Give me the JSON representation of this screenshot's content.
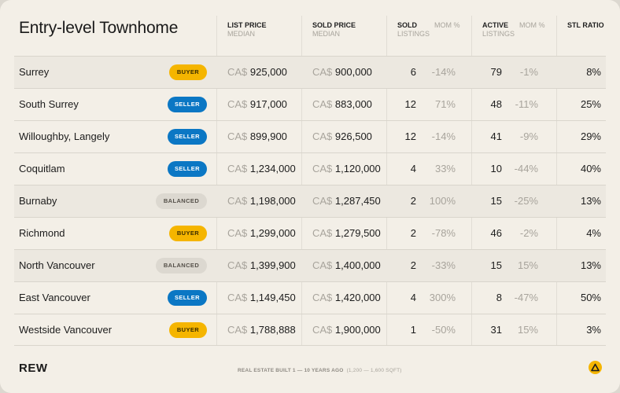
{
  "title": "Entry-level Townhome",
  "headers": {
    "list_price": "LIST PRICE",
    "list_price_sub": "MEDIAN",
    "sold_price": "SOLD PRICE",
    "sold_price_sub": "MEDIAN",
    "sold": "SOLD",
    "sold_sub": "LISTINGS",
    "sold_mom": "MOM %",
    "active": "ACTIVE",
    "active_sub": "LISTINGS",
    "active_mom": "MOM %",
    "stl": "STL RATIO"
  },
  "currency": "CA$",
  "rows": [
    {
      "city": "Surrey",
      "market": "BUYER",
      "market_type": "buyer",
      "list": "925,000",
      "sold_price": "900,000",
      "sold": "6",
      "sold_mom": "-14%",
      "active": "79",
      "active_mom": "-1%",
      "stl": "8%"
    },
    {
      "city": "South Surrey",
      "market": "SELLER",
      "market_type": "seller",
      "list": "917,000",
      "sold_price": "883,000",
      "sold": "12",
      "sold_mom": "71%",
      "active": "48",
      "active_mom": "-11%",
      "stl": "25%"
    },
    {
      "city": "Willoughby, Langely",
      "market": "SELLER",
      "market_type": "seller",
      "list": "899,900",
      "sold_price": "926,500",
      "sold": "12",
      "sold_mom": "-14%",
      "active": "41",
      "active_mom": "-9%",
      "stl": "29%"
    },
    {
      "city": "Coquitlam",
      "market": "SELLER",
      "market_type": "seller",
      "list": "1,234,000",
      "sold_price": "1,120,000",
      "sold": "4",
      "sold_mom": "33%",
      "active": "10",
      "active_mom": "-44%",
      "stl": "40%"
    },
    {
      "city": "Burnaby",
      "market": "BALANCED",
      "market_type": "balanced",
      "list": "1,198,000",
      "sold_price": "1,287,450",
      "sold": "2",
      "sold_mom": "100%",
      "active": "15",
      "active_mom": "-25%",
      "stl": "13%"
    },
    {
      "city": "Richmond",
      "market": "BUYER",
      "market_type": "buyer",
      "list": "1,299,000",
      "sold_price": "1,279,500",
      "sold": "2",
      "sold_mom": "-78%",
      "active": "46",
      "active_mom": "-2%",
      "stl": "4%"
    },
    {
      "city": "North Vancouver",
      "market": "BALANCED",
      "market_type": "balanced",
      "list": "1,399,900",
      "sold_price": "1,400,000",
      "sold": "2",
      "sold_mom": "-33%",
      "active": "15",
      "active_mom": "15%",
      "stl": "13%"
    },
    {
      "city": "East Vancouver",
      "market": "SELLER",
      "market_type": "seller",
      "list": "1,149,450",
      "sold_price": "1,420,000",
      "sold": "4",
      "sold_mom": "300%",
      "active": "8",
      "active_mom": "-47%",
      "stl": "50%"
    },
    {
      "city": "Westside Vancouver",
      "market": "BUYER",
      "market_type": "buyer",
      "list": "1,788,888",
      "sold_price": "1,900,000",
      "sold": "1",
      "sold_mom": "-50%",
      "active": "31",
      "active_mom": "15%",
      "stl": "3%"
    }
  ],
  "footer": {
    "logo": "REW",
    "note_bold": "REAL ESTATE BUILT 1 — 10 YEARS AGO",
    "note_light": "(1,200 — 1,600 SQFT)",
    "icon": "warning-triangle-icon",
    "icon_color": "#f5b500"
  },
  "colors": {
    "buyer": "#f5b500",
    "seller": "#0b77c4",
    "balanced": "#dcd8d0"
  }
}
